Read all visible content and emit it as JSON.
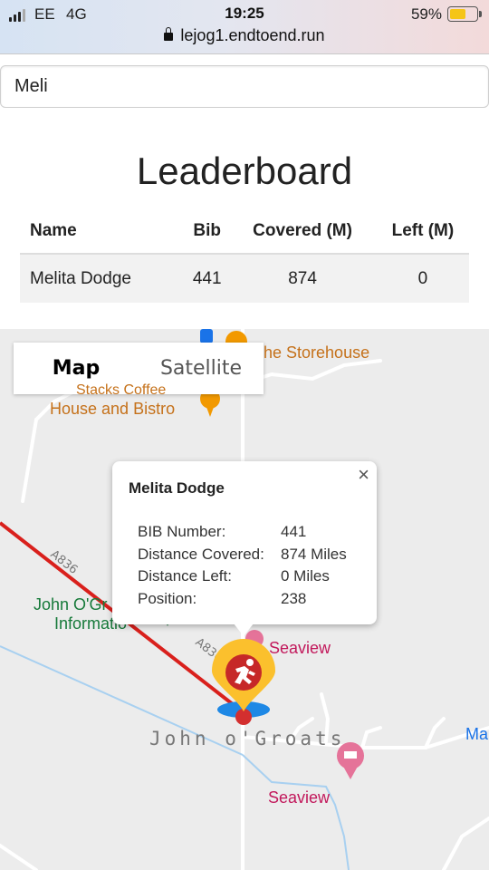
{
  "status": {
    "carrier": "EE",
    "network": "4G",
    "time": "19:25",
    "battery_percent": "59%",
    "battery_level": 0.59,
    "battery_color": "#f5c518",
    "url": "lejog1.endtoend.run"
  },
  "search": {
    "value": "Meli"
  },
  "leaderboard": {
    "title": "Leaderboard",
    "columns": [
      "Name",
      "Bib",
      "Covered (M)",
      "Left (M)"
    ],
    "rows": [
      {
        "name": "Melita Dodge",
        "bib": "441",
        "covered": "874",
        "left": "0"
      }
    ]
  },
  "map": {
    "tabs": {
      "map": "Map",
      "satellite": "Satellite"
    },
    "pois": {
      "storehouse": "he Storehouse",
      "stacks": "Stacks Coffee",
      "bistro": "House and Bistro",
      "info_1": "John O'Gr",
      "info_2": "Informatio",
      "seaview_1": "Seaview",
      "seaview_2": "Seaview",
      "edge_label": "Ma"
    },
    "road_labels": {
      "a": "A836",
      "b": "A836"
    },
    "place_name": "John o'Groats",
    "route_color": "#d9201c",
    "marker_color": "#fbc02d",
    "marker_badge_color": "#c62828",
    "marker_icon": "runner-icon"
  },
  "infowindow": {
    "name": "Melita Dodge",
    "close": "×",
    "fields": [
      {
        "label": "BIB Number:",
        "value": "441"
      },
      {
        "label": "Distance Covered:",
        "value": "874 Miles"
      },
      {
        "label": "Distance Left:",
        "value": "0 Miles"
      },
      {
        "label": "Position:",
        "value": "238"
      }
    ]
  }
}
